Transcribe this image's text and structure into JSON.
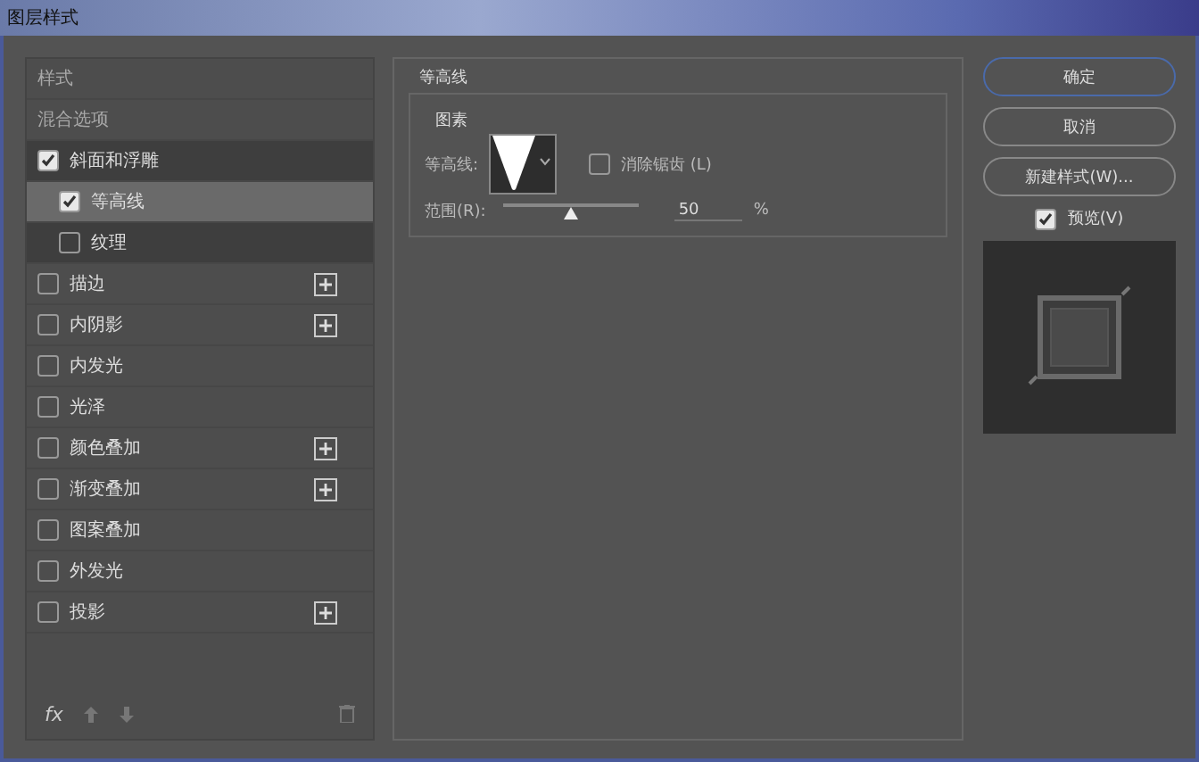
{
  "window": {
    "title": "图层样式"
  },
  "sidebar": {
    "items": [
      {
        "kind": "header",
        "label": "样式",
        "selected": false
      },
      {
        "kind": "header",
        "label": "混合选项",
        "selected": false
      },
      {
        "kind": "check",
        "label": "斜面和浮雕",
        "checked": true,
        "selected": false,
        "addable": false,
        "children": [
          {
            "kind": "check",
            "label": "等高线",
            "checked": true,
            "selected": true,
            "addable": false
          },
          {
            "kind": "check",
            "label": "纹理",
            "checked": false,
            "selected": false,
            "addable": false
          }
        ]
      },
      {
        "kind": "check",
        "label": "描边",
        "checked": false,
        "selected": false,
        "addable": true
      },
      {
        "kind": "check",
        "label": "内阴影",
        "checked": false,
        "selected": false,
        "addable": true
      },
      {
        "kind": "check",
        "label": "内发光",
        "checked": false,
        "selected": false,
        "addable": false
      },
      {
        "kind": "check",
        "label": "光泽",
        "checked": false,
        "selected": false,
        "addable": false
      },
      {
        "kind": "check",
        "label": "颜色叠加",
        "checked": false,
        "selected": false,
        "addable": true
      },
      {
        "kind": "check",
        "label": "渐变叠加",
        "checked": false,
        "selected": false,
        "addable": true
      },
      {
        "kind": "check",
        "label": "图案叠加",
        "checked": false,
        "selected": false,
        "addable": false
      },
      {
        "kind": "check",
        "label": "外发光",
        "checked": false,
        "selected": false,
        "addable": false
      },
      {
        "kind": "check",
        "label": "投影",
        "checked": false,
        "selected": false,
        "addable": true
      }
    ],
    "footer": {
      "fx": "fx"
    }
  },
  "panel": {
    "title": "等高线",
    "group": "图素",
    "contour_label": "等高线:",
    "antialias": {
      "label": "消除锯齿 (L)",
      "checked": false
    },
    "range": {
      "label": "范围(R):",
      "level": 0.5,
      "value": "50",
      "unit": "%"
    }
  },
  "buttons": [
    {
      "label": "确定",
      "primary": true
    },
    {
      "label": "取消",
      "primary": false
    },
    {
      "label": "新建样式(W)...",
      "primary": false
    }
  ],
  "preview": {
    "label": "预览(V)",
    "checked": true
  }
}
